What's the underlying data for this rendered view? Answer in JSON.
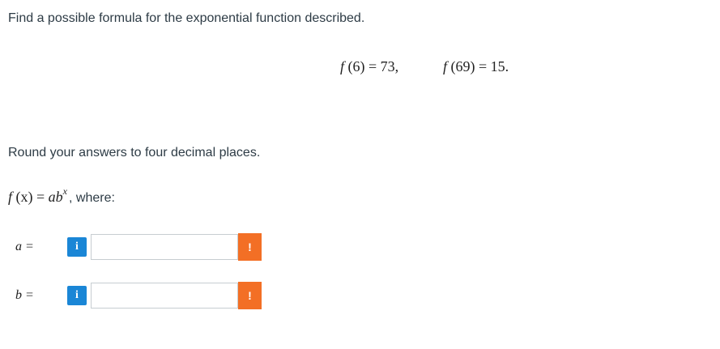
{
  "prompt": "Find a possible formula for the exponential function described.",
  "given": {
    "eq1": {
      "f": "f",
      "arg": "(6)",
      "rel": "=",
      "val": "73,"
    },
    "eq2": {
      "f": "f",
      "arg": "(69)",
      "rel": "=",
      "val": "15."
    }
  },
  "instruction": "Round your answers to four decimal places.",
  "formula": {
    "lhs_f": "f",
    "lhs_arg": "(x)",
    "rel": "=",
    "rhs_base": "ab",
    "rhs_exp": "x",
    "tail": ", where:"
  },
  "answers": [
    {
      "label": "a =",
      "value": "",
      "info_icon": "i",
      "warn_icon": "!"
    },
    {
      "label": "b =",
      "value": "",
      "info_icon": "i",
      "warn_icon": "!"
    }
  ],
  "colors": {
    "info": "#1a86d6",
    "warning": "#f36f25",
    "text": "#2d3b45"
  }
}
